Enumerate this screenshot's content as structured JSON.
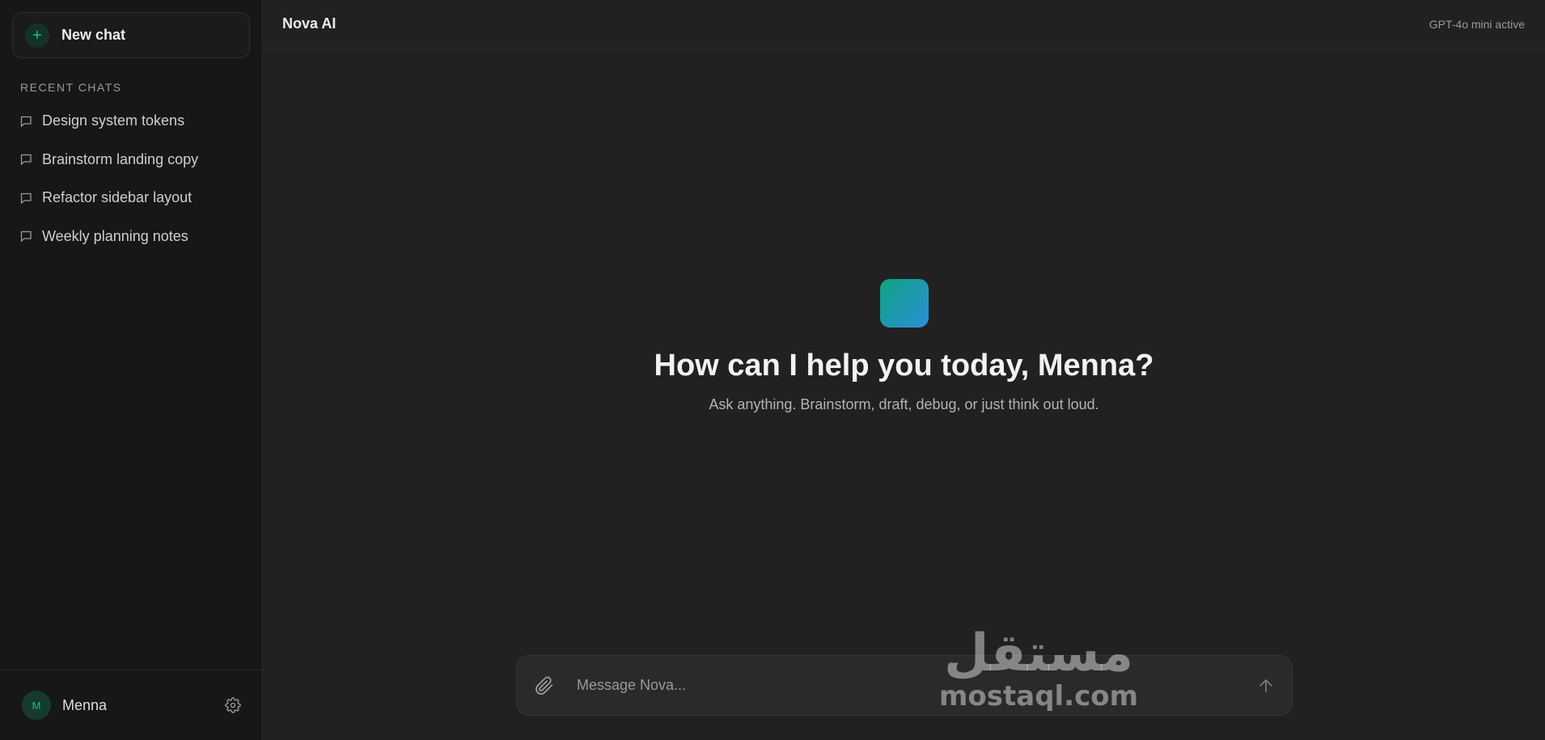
{
  "sidebar": {
    "new_chat_label": "New chat",
    "recent_title": "RECENT CHATS",
    "items": [
      {
        "label": "Design system tokens"
      },
      {
        "label": "Brainstorm landing copy"
      },
      {
        "label": "Refactor sidebar layout"
      },
      {
        "label": "Weekly planning notes"
      }
    ],
    "user": {
      "initial": "M",
      "name": "Menna"
    }
  },
  "header": {
    "title": "Nova AI",
    "model_status": "GPT-4o mini active"
  },
  "hero": {
    "greeting": "How can I help you today, Menna?",
    "subtitle": "Ask anything. Brainstorm, draft, debug, or just think out loud."
  },
  "composer": {
    "placeholder": "Message Nova..."
  },
  "watermark": {
    "arabic": "مستقل",
    "latin": "mostaql.com"
  },
  "colors": {
    "accent": "#19c37d",
    "logo_gradient_start": "#10a37f",
    "logo_gradient_end": "#2b8fd9",
    "background": "#212121",
    "sidebar": "#171717"
  }
}
